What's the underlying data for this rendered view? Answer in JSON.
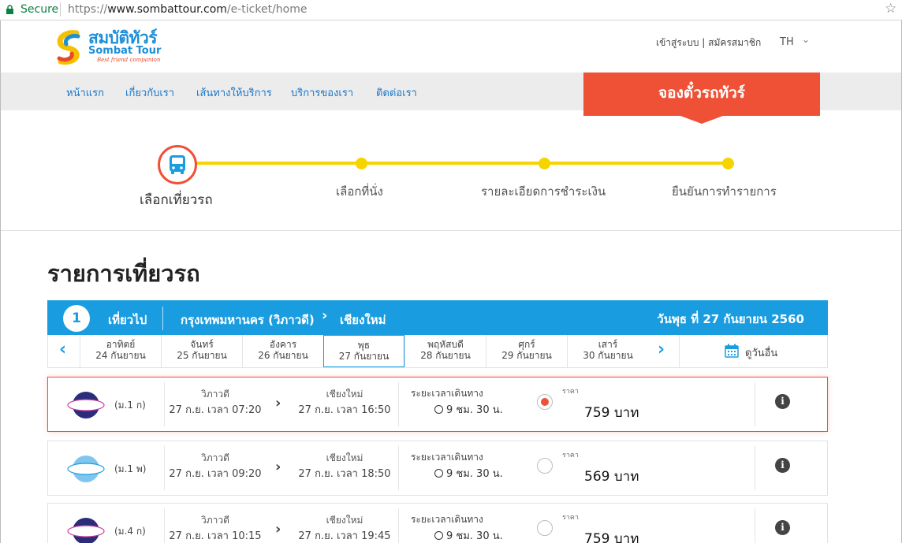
{
  "browser": {
    "secure_label": "Secure",
    "url_scheme": "https://",
    "url_host": "www.sombattour.com",
    "url_path": "/e-ticket/home"
  },
  "header": {
    "logo_th": "สมบัติทัวร์",
    "logo_en": "Sombat Tour",
    "logo_tagline": "Best friend companion",
    "auth_links": "เข้าสู่ระบบ | สมัครสมาชิก",
    "language": "TH"
  },
  "nav": {
    "items": [
      "หน้าแรก",
      "เกี่ยวกับเรา",
      "เส้นทางให้บริการ",
      "บริการของเรา",
      "ติดต่อเรา"
    ],
    "book_button": "จองตั๋วรถทัวร์"
  },
  "steps": {
    "items": [
      "เลือกเที่ยวรถ",
      "เลือกที่นั่ง",
      "รายละเอียดการชำระเงิน",
      "ยืนยันการทำรายการ"
    ],
    "active_index": 0
  },
  "section_title": "รายการเที่ยวรถ",
  "trip": {
    "number": "1",
    "type": "เที่ยวไป",
    "origin": "กรุงเทพมหานคร (วิภาวดี)",
    "arrow": "›",
    "destination": "เชียงใหม่",
    "date": "วันพุธ ที่ 27 กันยายน 2560"
  },
  "dates": {
    "days": [
      {
        "day": "อาทิตย์",
        "date": "24 กันยายน"
      },
      {
        "day": "จันทร์",
        "date": "25 กันยายน"
      },
      {
        "day": "อังคาร",
        "date": "26 กันยายน"
      },
      {
        "day": "พุธ",
        "date": "27 กันยายน"
      },
      {
        "day": "พฤหัสบดี",
        "date": "28 กันยายน"
      },
      {
        "day": "ศุกร์",
        "date": "29 กันยายน"
      },
      {
        "day": "เสาร์",
        "date": "30 กันยายน"
      }
    ],
    "selected_index": 3,
    "other_day_label": "ดูวันอื่น"
  },
  "results": [
    {
      "bus_class": "(ม.1 ก)",
      "badge": "Supreme",
      "from": "วิภาวดี",
      "from_time": "27 ก.ย. เวลา 07:20",
      "to": "เชียงใหม่",
      "to_time": "27 ก.ย. เวลา 16:50",
      "duration_label": "ระยะเวลาเดินทาง",
      "duration": "9 ชม. 30 น.",
      "price_label": "ราคา",
      "price": "759 บาท",
      "selected": true
    },
    {
      "bus_class": "(ม.1 พ)",
      "badge": "Super",
      "from": "วิภาวดี",
      "from_time": "27 ก.ย. เวลา 09:20",
      "to": "เชียงใหม่",
      "to_time": "27 ก.ย. เวลา 18:50",
      "duration_label": "ระยะเวลาเดินทาง",
      "duration": "9 ชม. 30 น.",
      "price_label": "ราคา",
      "price": "569 บาท",
      "selected": false
    },
    {
      "bus_class": "(ม.4 ก)",
      "badge": "Supreme",
      "from": "วิภาวดี",
      "from_time": "27 ก.ย. เวลา 10:15",
      "to": "เชียงใหม่",
      "to_time": "27 ก.ย. เวลา 19:45",
      "duration_label": "ระยะเวลาเดินทาง",
      "duration": "9 ชม. 30 น.",
      "price_label": "ราคา",
      "price": "759 บาท",
      "selected": false
    }
  ],
  "colors": {
    "accent": "#ef5136",
    "blue": "#1a9de0",
    "progress": "#f6d400",
    "nav_bg": "#ececec"
  }
}
